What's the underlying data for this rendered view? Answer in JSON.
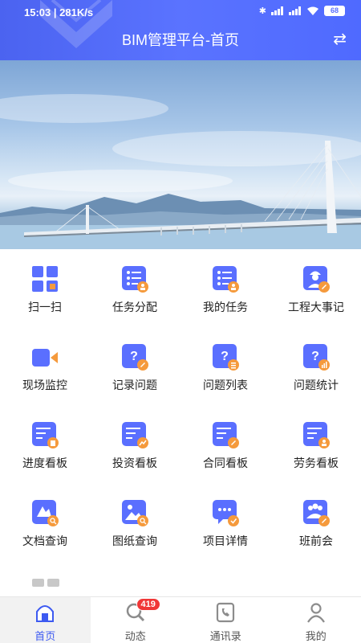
{
  "status_bar": {
    "time": "15:03",
    "speed": "281K/s",
    "battery": "68"
  },
  "header": {
    "title": "BIM管理平台-首页"
  },
  "menu": [
    {
      "label": "扫一扫",
      "icon": "scan-icon"
    },
    {
      "label": "任务分配",
      "icon": "task-assign-icon"
    },
    {
      "label": "我的任务",
      "icon": "my-task-icon"
    },
    {
      "label": "工程大事记",
      "icon": "engineer-icon"
    },
    {
      "label": "现场监控",
      "icon": "video-camera-icon"
    },
    {
      "label": "记录问题",
      "icon": "record-question-icon"
    },
    {
      "label": "问题列表",
      "icon": "question-list-icon"
    },
    {
      "label": "问题统计",
      "icon": "question-stats-icon"
    },
    {
      "label": "进度看板",
      "icon": "progress-board-icon"
    },
    {
      "label": "投资看板",
      "icon": "investment-board-icon"
    },
    {
      "label": "合同看板",
      "icon": "contract-board-icon"
    },
    {
      "label": "劳务看板",
      "icon": "labor-board-icon"
    },
    {
      "label": "文档查询",
      "icon": "document-search-icon"
    },
    {
      "label": "图纸查询",
      "icon": "drawing-search-icon"
    },
    {
      "label": "项目详情",
      "icon": "project-detail-icon"
    },
    {
      "label": "班前会",
      "icon": "meeting-icon"
    }
  ],
  "bottom_nav": [
    {
      "label": "首页",
      "icon": "home-icon",
      "active": true
    },
    {
      "label": "动态",
      "icon": "search-icon",
      "badge": "419"
    },
    {
      "label": "通讯录",
      "icon": "contacts-icon"
    },
    {
      "label": "我的",
      "icon": "profile-icon"
    }
  ],
  "colors": {
    "primary": "#5a6fff",
    "accent_orange": "#f59a3c"
  }
}
